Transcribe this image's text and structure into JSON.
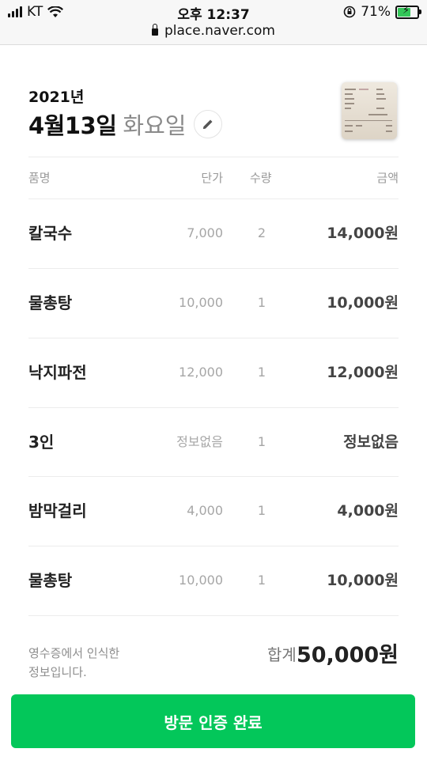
{
  "status_bar": {
    "carrier": "KT",
    "time": "오후 12:37",
    "battery_percent": "71%",
    "battery_level": 0.71,
    "url": "place.naver.com",
    "icons": [
      "signal-bars-icon",
      "wifi-icon",
      "orientation-lock-icon",
      "battery-charging-icon",
      "lock-icon"
    ]
  },
  "header": {
    "year": "2021년",
    "date": "4월13일",
    "weekday": "화요일",
    "edit_icon": "pencil-icon"
  },
  "table": {
    "columns": [
      "품명",
      "단가",
      "수량",
      "금액"
    ],
    "rows": [
      {
        "name": "칼국수",
        "price": "7,000",
        "qty": "2",
        "amount": "14,000원"
      },
      {
        "name": "물총탕",
        "price": "10,000",
        "qty": "1",
        "amount": "10,000원"
      },
      {
        "name": "낙지파전",
        "price": "12,000",
        "qty": "1",
        "amount": "12,000원"
      },
      {
        "name": "3인",
        "price": "정보없음",
        "qty": "1",
        "amount": "정보없음"
      },
      {
        "name": "밤막걸리",
        "price": "4,000",
        "qty": "1",
        "amount": "4,000원"
      },
      {
        "name": "물총탕",
        "price": "10,000",
        "qty": "1",
        "amount": "10,000원"
      }
    ]
  },
  "footer": {
    "note_line1": "영수증에서 인식한",
    "note_line2": "정보입니다.",
    "total_label": "합계",
    "total_value": "50,000원"
  },
  "confirm_button": {
    "label": "방문 인증 완료",
    "color": "#03c75a"
  }
}
